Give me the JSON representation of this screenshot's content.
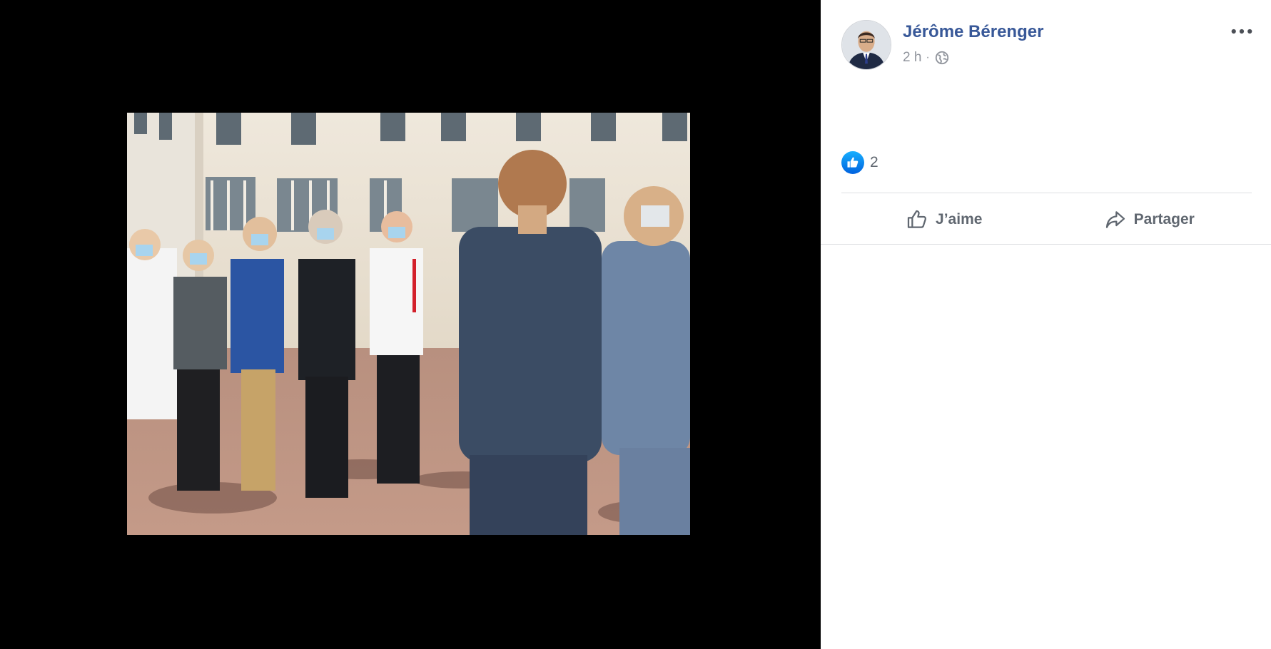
{
  "photo": {
    "alt": "Photo"
  },
  "post": {
    "author_name": "Jérôme Bérenger",
    "timestamp": "2 h",
    "separator": "·",
    "audience_icon": "globe-icon",
    "more_icon": "more-options-icon",
    "reaction_icon": "like-reaction-icon",
    "reaction_count": "2"
  },
  "actions": {
    "like_label": "J’aime",
    "like_icon": "thumbs-up-outline-icon",
    "share_label": "Partager",
    "share_icon": "share-arrow-icon"
  },
  "colors": {
    "viewer_background": "#000000",
    "panel_background": "#ffffff",
    "author_link": "#385898",
    "meta_text": "#90949c",
    "action_text": "#606770",
    "like_blue": "#1877f2",
    "divider": "#dddfe2"
  }
}
